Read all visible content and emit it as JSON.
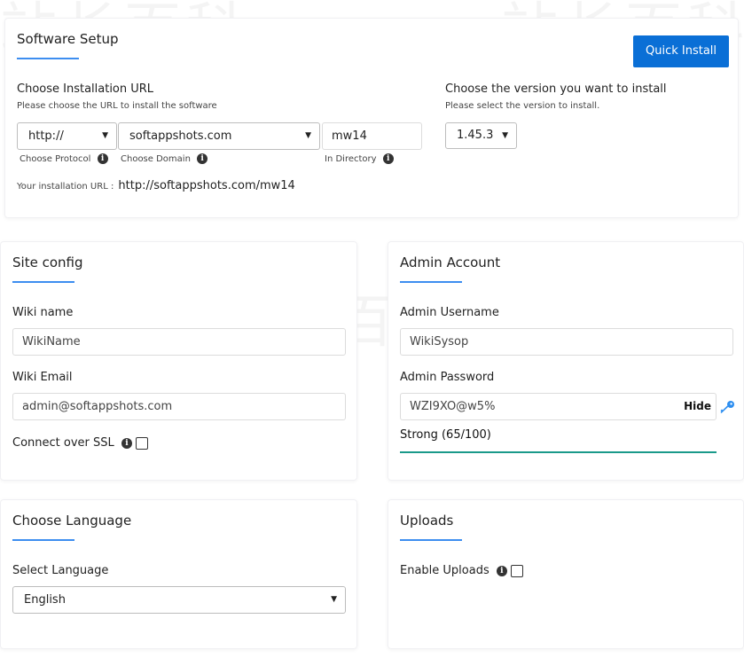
{
  "watermark": "站长百科",
  "software_setup": {
    "title": "Software Setup",
    "quick_install_label": "Quick Install",
    "install_url_heading": "Choose Installation URL",
    "install_url_hint": "Please choose the URL to install the software",
    "protocol_value": "http://",
    "domain_value": "softappshots.com",
    "directory_value": "mw14",
    "protocol_label": "Choose Protocol",
    "domain_label": "Choose Domain",
    "directory_label": "In Directory",
    "install_url_prefix": "Your installation URL :",
    "install_url_value": "http://softappshots.com/mw14",
    "version_heading": "Choose the version you want to install",
    "version_hint": "Please select the version to install.",
    "version_value": "1.45.3"
  },
  "site_config": {
    "title": "Site config",
    "wiki_name_label": "Wiki name",
    "wiki_name_value": "WikiName",
    "wiki_email_label": "Wiki Email",
    "wiki_email_value": "admin@softappshots.com",
    "ssl_label": "Connect over SSL"
  },
  "admin_account": {
    "title": "Admin Account",
    "username_label": "Admin Username",
    "username_value": "WikiSysop",
    "password_label": "Admin Password",
    "password_value": "WZI9XO@w5%",
    "hide_label": "Hide",
    "strength_text": "Strong (65/100)",
    "strength_percent": 100,
    "strength_color": "#1a9a8a"
  },
  "language": {
    "title": "Choose Language",
    "select_label": "Select Language",
    "selected_value": "English"
  },
  "uploads": {
    "title": "Uploads",
    "enable_label": "Enable Uploads"
  },
  "colors": {
    "accent": "#3d8ef0",
    "button": "#0a6fd6"
  }
}
